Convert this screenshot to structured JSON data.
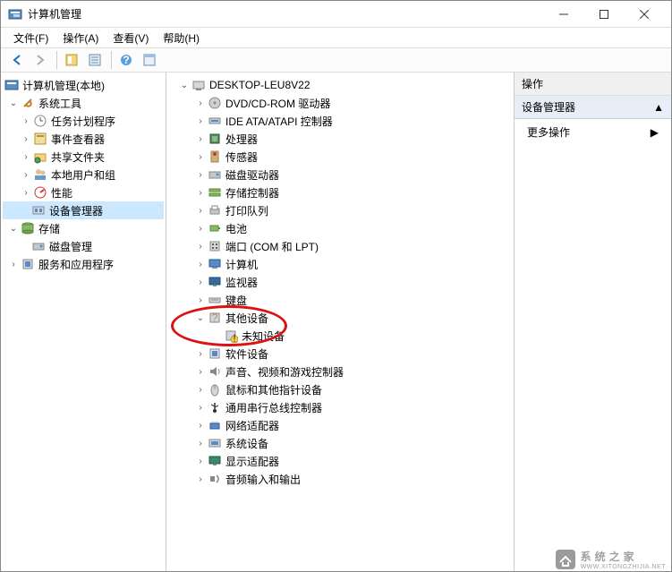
{
  "window": {
    "title": "计算机管理"
  },
  "menu": {
    "file": "文件(F)",
    "action": "操作(A)",
    "view": "查看(V)",
    "help": "帮助(H)"
  },
  "leftTree": {
    "root": "计算机管理(本地)",
    "sysTools": "系统工具",
    "taskScheduler": "任务计划程序",
    "eventViewer": "事件查看器",
    "sharedFolders": "共享文件夹",
    "localUsers": "本地用户和组",
    "performance": "性能",
    "deviceManager": "设备管理器",
    "storage": "存储",
    "diskMgmt": "磁盘管理",
    "services": "服务和应用程序"
  },
  "centerTree": {
    "root": "DESKTOP-LEU8V22",
    "dvd": "DVD/CD-ROM 驱动器",
    "ide": "IDE ATA/ATAPI 控制器",
    "cpu": "处理器",
    "sensor": "传感器",
    "diskDrive": "磁盘驱动器",
    "storageCtl": "存储控制器",
    "printQueue": "打印队列",
    "battery": "电池",
    "ports": "端口 (COM 和 LPT)",
    "computer": "计算机",
    "monitor": "监视器",
    "keyboard": "键盘",
    "otherDevices": "其他设备",
    "unknownDevice": "未知设备",
    "softwareDevices": "软件设备",
    "sound": "声音、视频和游戏控制器",
    "mouse": "鼠标和其他指针设备",
    "usb": "通用串行总线控制器",
    "network": "网络适配器",
    "system": "系统设备",
    "display": "显示适配器",
    "audioIO": "音频输入和输出"
  },
  "right": {
    "header": "操作",
    "section": "设备管理器",
    "more": "更多操作"
  },
  "watermark": {
    "text": "系统之家",
    "url": "WWW.XITONGZHIJIA.NET"
  }
}
